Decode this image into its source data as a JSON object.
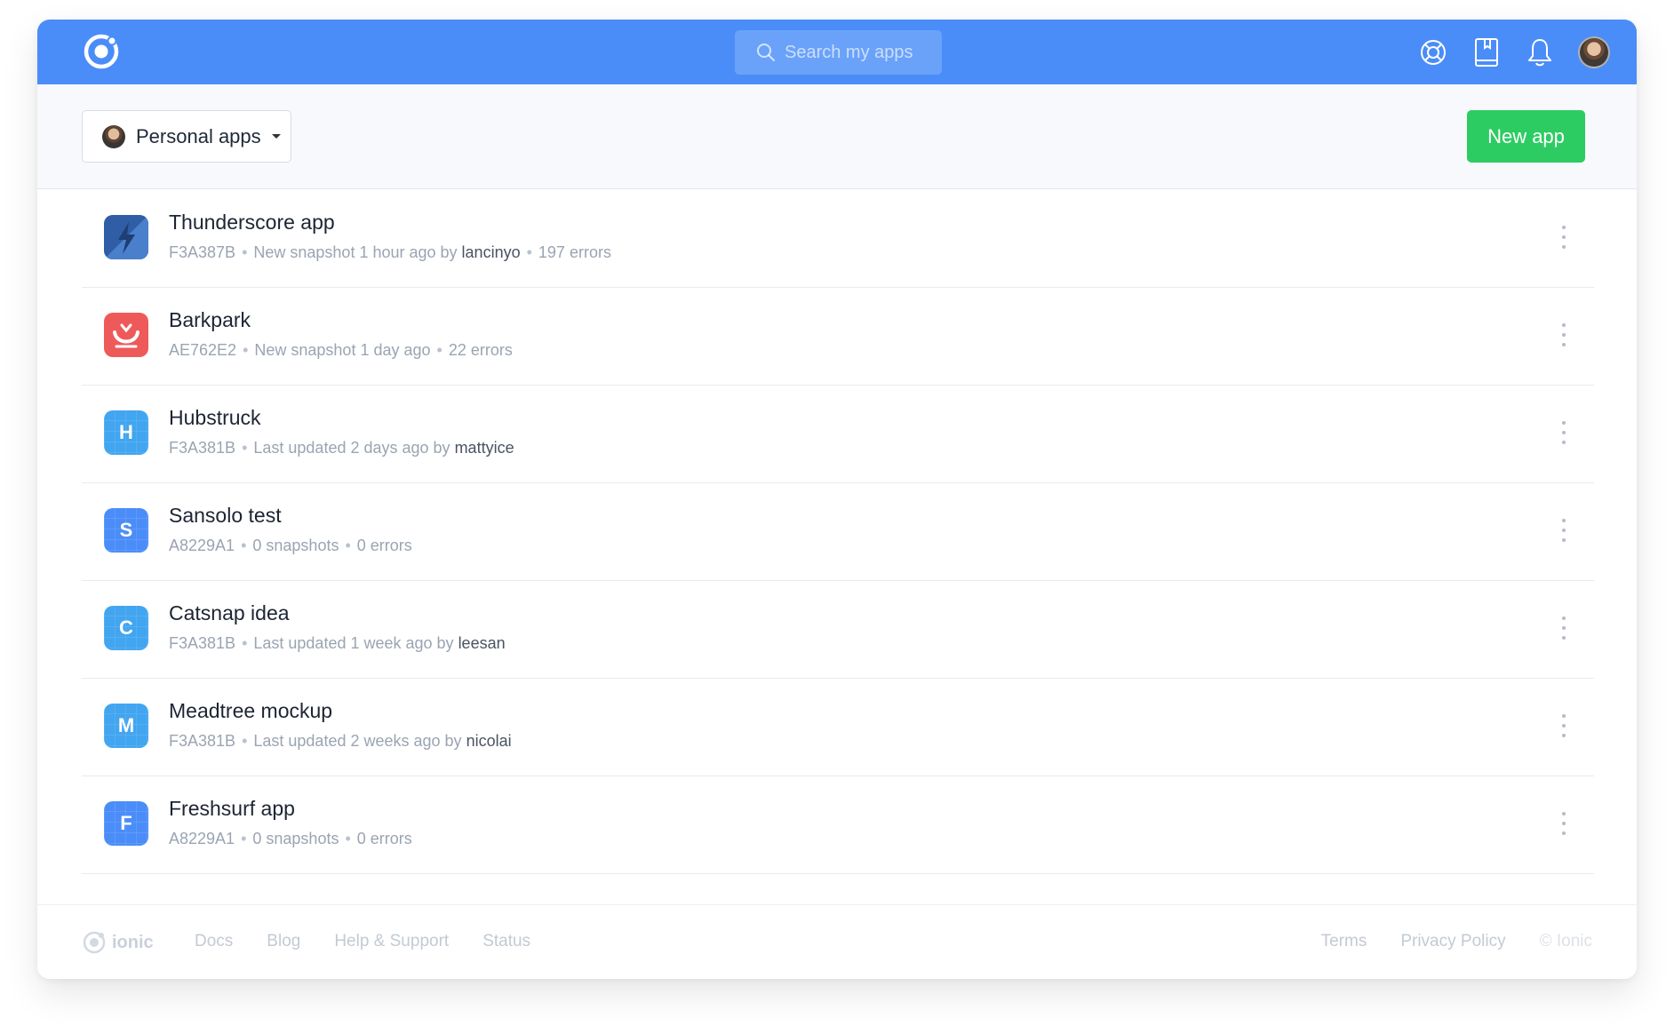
{
  "header": {
    "search_placeholder": "Search my apps",
    "icons": [
      "ionic-logo-icon",
      "lifebuoy-icon",
      "book-icon",
      "bell-icon",
      "avatar"
    ]
  },
  "toolbar": {
    "scope_label": "Personal apps",
    "new_app_label": "New app"
  },
  "apps": [
    {
      "name": "Thunderscore app",
      "id": "F3A387B",
      "status": "New snapshot 1 hour ago by",
      "user": "lancinyo",
      "errors": "197 errors",
      "icon": "bolt-icon",
      "color": "#3d6fb8"
    },
    {
      "name": "Barkpark",
      "id": "AE762E2",
      "status": "New snapshot 1 day ago",
      "user": "",
      "errors": "22 errors",
      "icon": "bowl-icon",
      "color": "#ee5a5a"
    },
    {
      "name": "Hubstruck",
      "id": "F3A381B",
      "status": "Last updated 2 days ago by",
      "user": "mattyice",
      "errors": "",
      "icon": "letter-H",
      "letter": "H",
      "color": "#42a5f0"
    },
    {
      "name": "Sansolo test",
      "id": "A8229A1",
      "status": "0 snapshots",
      "user": "",
      "errors": "0 errors",
      "icon": "letter-S",
      "letter": "S",
      "color": "#4b8df8"
    },
    {
      "name": "Catsnap idea",
      "id": "F3A381B",
      "status": "Last updated 1 week ago by",
      "user": "leesan",
      "errors": "",
      "icon": "letter-C",
      "letter": "C",
      "color": "#42a5f0"
    },
    {
      "name": "Meadtree mockup",
      "id": "F3A381B",
      "status": "Last updated 2 weeks ago by",
      "user": "nicolai",
      "errors": "",
      "icon": "letter-M",
      "letter": "M",
      "color": "#42a5f0"
    },
    {
      "name": "Freshsurf app",
      "id": "A8229A1",
      "status": "0 snapshots",
      "user": "",
      "errors": "0 errors",
      "icon": "letter-F",
      "letter": "F",
      "color": "#4b8df8"
    }
  ],
  "footer": {
    "brand": "ionic",
    "links": [
      "Docs",
      "Blog",
      "Help & Support",
      "Status"
    ],
    "right_links": [
      "Terms",
      "Privacy Policy"
    ],
    "copyright": "© Ionic"
  }
}
